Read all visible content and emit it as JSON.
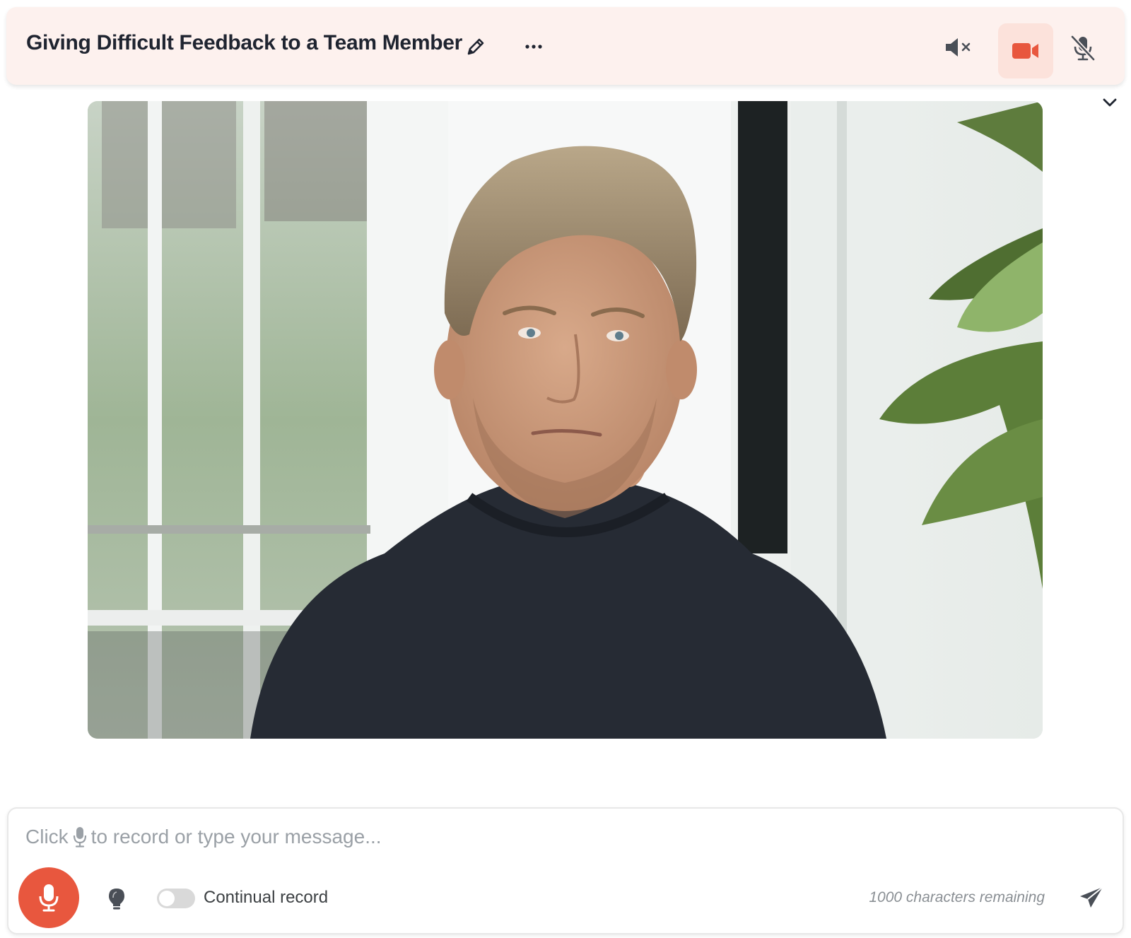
{
  "header": {
    "title": "Giving Difficult Feedback to a Team Member",
    "icons": {
      "edit": "pencil-icon",
      "more": "more-horizontal-icon",
      "speaker": "speaker-muted-icon",
      "camera": "video-camera-icon",
      "microphone": "microphone-off-icon"
    }
  },
  "collapse": {
    "icon": "chevron-down-icon"
  },
  "video": {
    "content": "video-feed"
  },
  "composer": {
    "placeholder_prefix": "Click",
    "placeholder_suffix": "to record or type your message...",
    "continual_record_label": "Continual record",
    "continual_record_on": false,
    "characters_remaining": "1000 characters remaining",
    "icons": {
      "record": "microphone-icon",
      "hint": "lightbulb-icon",
      "send": "send-icon"
    }
  },
  "colors": {
    "accent": "#e8573e",
    "header_bg": "#fdf1ee",
    "camera_active_bg": "#fce2db",
    "text_primary": "#1f2430",
    "text_muted": "#9aa0a6"
  }
}
